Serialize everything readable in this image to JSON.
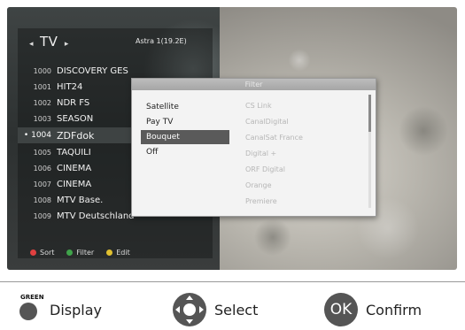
{
  "header": {
    "title": "TV",
    "satellite": "Astra 1(19.2E)"
  },
  "channels": [
    {
      "num": "1000",
      "name": "DISCOVERY GES",
      "locked": false
    },
    {
      "num": "1001",
      "name": "HIT24",
      "locked": false
    },
    {
      "num": "1002",
      "name": "NDR FS",
      "locked": false
    },
    {
      "num": "1003",
      "name": "SEASON",
      "locked": false
    },
    {
      "num": "1004",
      "name": "ZDFdok",
      "locked": false,
      "selected": true
    },
    {
      "num": "1005",
      "name": "TAQUILI",
      "locked": false
    },
    {
      "num": "1006",
      "name": "CINEMA",
      "locked": false
    },
    {
      "num": "1007",
      "name": "CINEMA",
      "locked": false
    },
    {
      "num": "1008",
      "name": "MTV Base.",
      "locked": true
    },
    {
      "num": "1009",
      "name": "MTV Deutschland",
      "locked": false
    }
  ],
  "selected_marker": "•",
  "bottom_bar": [
    {
      "label": "Sort",
      "color": "#e04040"
    },
    {
      "label": "Filter",
      "color": "#3fa34a"
    },
    {
      "label": "Edit",
      "color": "#e0c030"
    }
  ],
  "dialog": {
    "title": "Filter",
    "options": [
      "Satellite",
      "Pay TV",
      "Bouquet",
      "Off"
    ],
    "selected_option": 2,
    "providers": [
      "CS Link",
      "CanalDigital",
      "CanalSat France",
      "Digital +",
      "ORF Digital",
      "Orange",
      "Premiere"
    ]
  },
  "legend": {
    "green_tag": "GREEN",
    "display_label": "Display",
    "select_label": "Select",
    "ok_label": "OK",
    "confirm_label": "Confirm"
  }
}
